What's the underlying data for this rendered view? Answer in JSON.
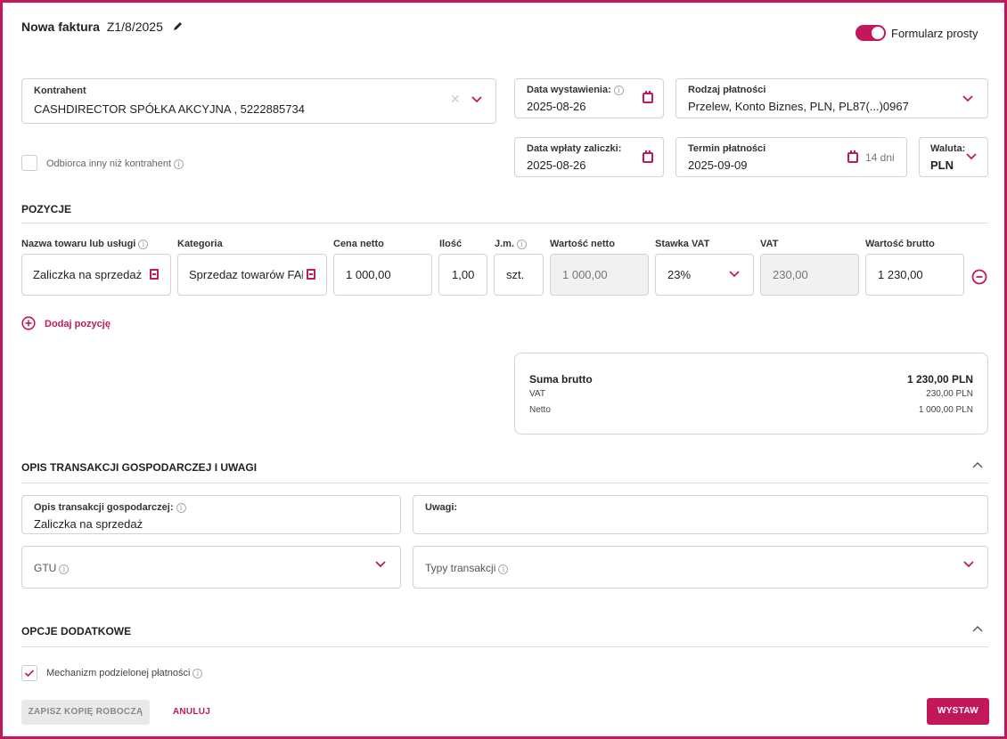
{
  "header": {
    "title": "Nowa faktura",
    "number": "Z1/8/2025",
    "toggle_label": "Formularz prosty"
  },
  "contractor": {
    "label": "Kontrahent",
    "value": "CASHDIRECTOR SPÓŁKA AKCYJNA , 5222885734"
  },
  "issue_date": {
    "label": "Data wystawienia:",
    "value": "2025-08-26"
  },
  "payment_type": {
    "label": "Rodzaj płatności",
    "value": "Przelew, Konto Biznes, PLN, PL87(...)0967"
  },
  "recipient_checkbox_label": "Odbiorca inny niż kontrahent",
  "advance_date": {
    "label": "Data wpłaty zaliczki:",
    "value": "2025-08-26"
  },
  "payment_term": {
    "label": "Termin płatności",
    "value": "2025-09-09",
    "days": "14 dni"
  },
  "currency": {
    "label": "Waluta:",
    "value": "PLN"
  },
  "positions": {
    "section_title": "POZYCJE",
    "columns": {
      "name": "Nazwa towaru lub usługi",
      "category": "Kategoria",
      "net_price": "Cena netto",
      "quantity": "Ilość",
      "unit": "J.m.",
      "net_value": "Wartość netto",
      "vat_rate": "Stawka VAT",
      "vat": "VAT",
      "gross_value": "Wartość brutto"
    },
    "rows": [
      {
        "name": "Zaliczka na sprzedaż",
        "category": "Sprzedaz towarów FAł",
        "net_price": "1 000,00",
        "quantity": "1,00",
        "unit": "szt.",
        "net_value": "1 000,00",
        "vat_rate": "23%",
        "vat": "230,00",
        "gross_value": "1 230,00"
      }
    ],
    "add_label": "Dodaj pozycję"
  },
  "summary": {
    "gross_label": "Suma brutto",
    "gross_value": "1 230,00 PLN",
    "vat_label": "VAT",
    "vat_value": "230,00 PLN",
    "net_label": "Netto",
    "net_value": "1 000,00 PLN"
  },
  "description_section": {
    "title": "OPIS TRANSAKCJI GOSPODARCZEJ I UWAGI",
    "desc_label": "Opis transakcji gospodarczej:",
    "desc_value": "Zaliczka na sprzedaż",
    "notes_label": "Uwagi:",
    "gtu_label": "GTU",
    "transaction_types_label": "Typy transakcji"
  },
  "options_section": {
    "title": "OPCJE DODATKOWE",
    "split_payment_label": "Mechanizm podzielonej płatności"
  },
  "buttons": {
    "save_draft": "ZAPISZ KOPIĘ ROBOCZĄ",
    "cancel": "ANULUJ",
    "issue": "WYSTAW"
  },
  "colors": {
    "accent": "#c2185b",
    "border": "#d3d3d3"
  }
}
